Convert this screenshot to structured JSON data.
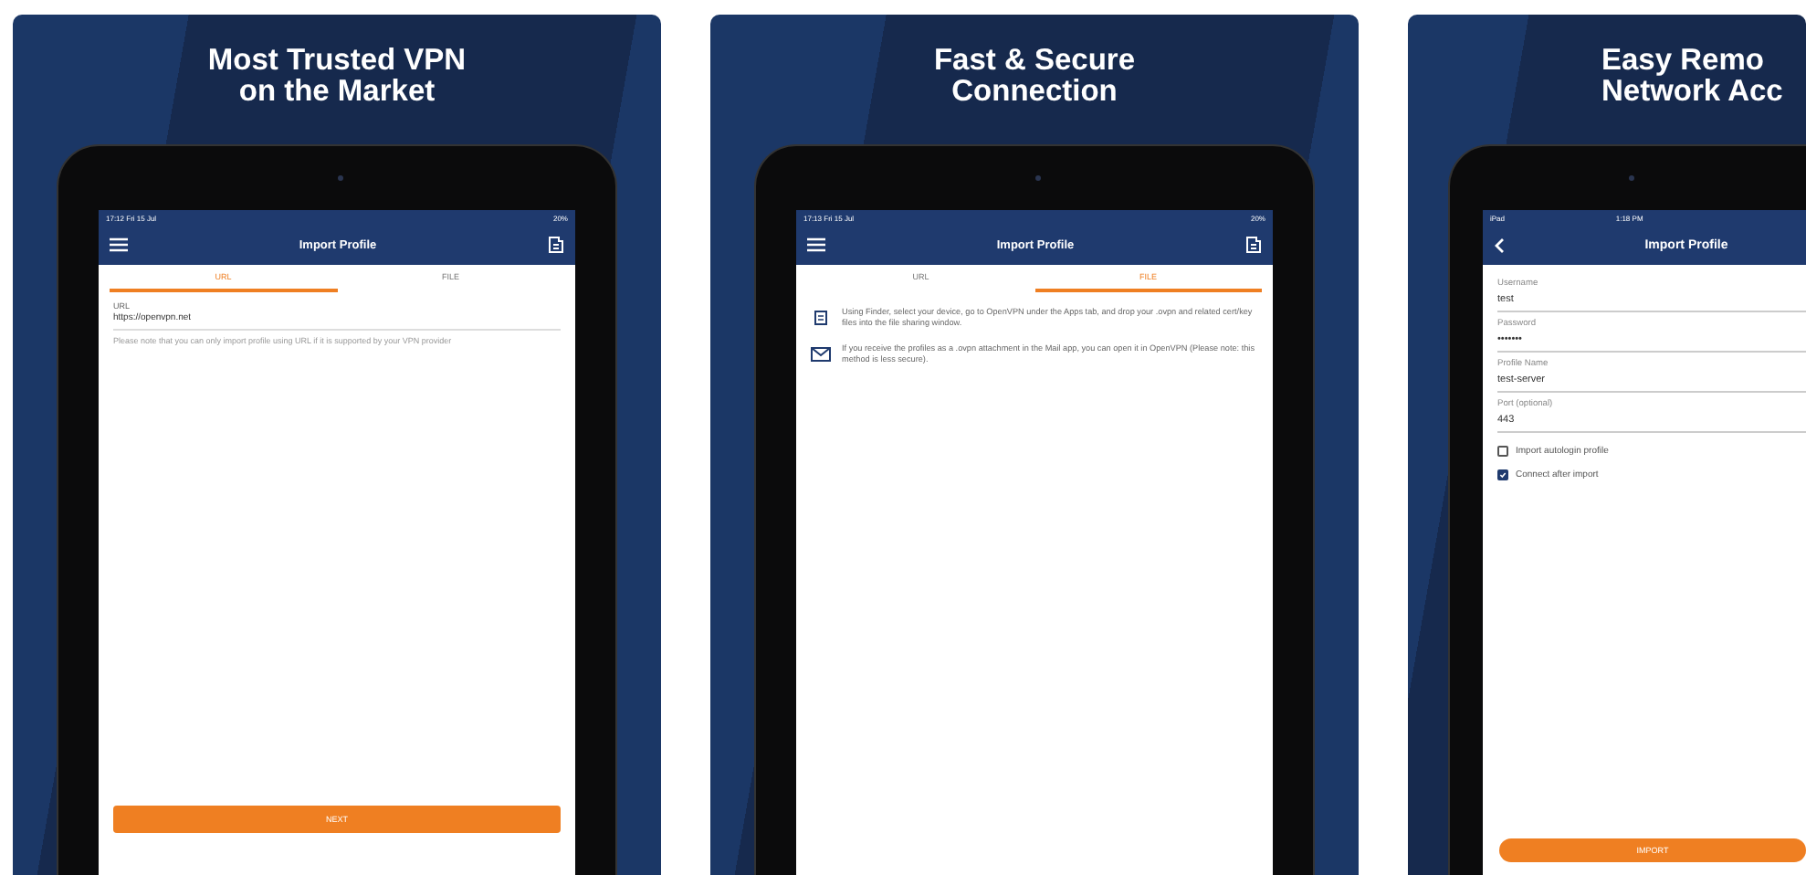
{
  "cards": [
    {
      "kind": "url",
      "title": [
        "Most Trusted VPN",
        "on the Market"
      ],
      "status": {
        "time": "17:12  Fri 15 Jul",
        "battery": "20%"
      },
      "nav_title": "Import Profile",
      "tabs": [
        {
          "label": "URL",
          "selected": true
        },
        {
          "label": "FILE",
          "selected": false
        }
      ],
      "field": {
        "label": "URL",
        "value": "https://openvpn.net"
      },
      "note": "Please note that you can only import profile using URL if it is supported by your VPN provider",
      "button": "NEXT"
    },
    {
      "kind": "file",
      "title": [
        "Fast & Secure",
        "Connection"
      ],
      "status": {
        "time": "17:13  Fri 15 Jul",
        "battery": "20%"
      },
      "nav_title": "Import Profile",
      "tabs": [
        {
          "label": "URL",
          "selected": false
        },
        {
          "label": "FILE",
          "selected": true
        }
      ],
      "items": [
        {
          "kind": "finder",
          "text": "Using Finder, select your device, go to OpenVPN under the Apps tab, and drop your .ovpn and related cert/key files into the file sharing window."
        },
        {
          "kind": "mail",
          "text": "If you receive the profiles as a .ovpn attachment in the Mail app, you can open it in OpenVPN (Please note: this method is less secure)."
        }
      ]
    },
    {
      "kind": "form",
      "title": [
        "Easy Remo",
        "Network Acc"
      ],
      "status": {
        "time": "1:18 PM",
        "device": "iPad"
      },
      "nav_title": "Import Profile",
      "fields": [
        {
          "label": "Username",
          "value": "test"
        },
        {
          "label": "Password",
          "value": "•••••••"
        },
        {
          "label": "Profile Name",
          "value": "test-server"
        },
        {
          "label": "Port (optional)",
          "value": "443"
        }
      ],
      "checkboxes": [
        {
          "label": "Import autologin profile",
          "checked": false
        },
        {
          "label": "Connect after import",
          "checked": true
        }
      ],
      "button": "IMPORT"
    }
  ]
}
